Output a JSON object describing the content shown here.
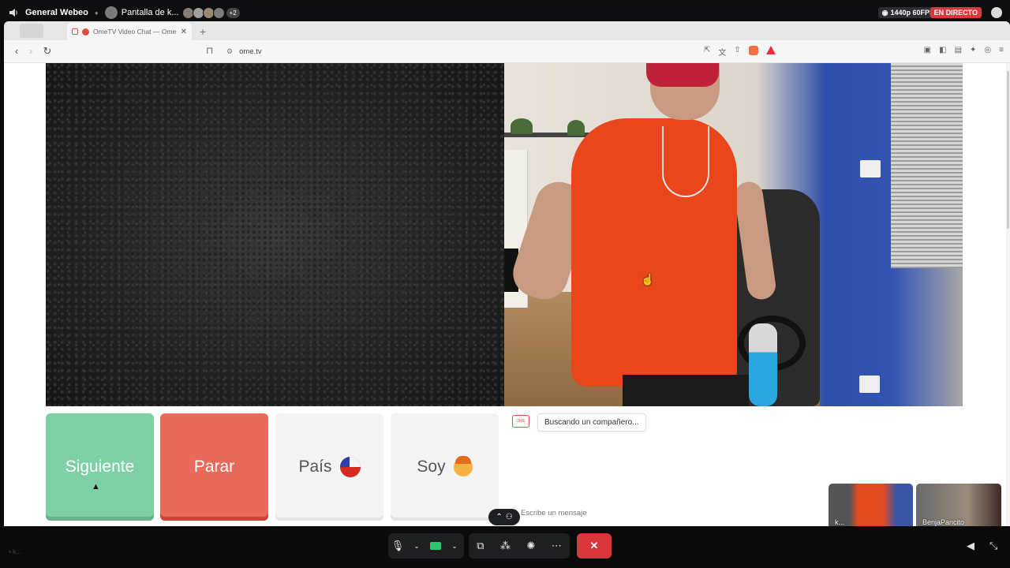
{
  "discord": {
    "channel_name": "General Webeo",
    "stream_title": "Pantalla de k...",
    "extra_viewers": "+2",
    "quality": "1440p 60FPS",
    "live_label": "EN DIRECTO"
  },
  "browser": {
    "tab_title": "OmeTV Video Chat — Ome",
    "url": "ome.tv"
  },
  "ometv": {
    "buttons": {
      "next": "Siguiente",
      "stop": "Parar",
      "country": "País",
      "me": "Soy"
    },
    "chat_status": "Buscando un compañero...",
    "chat_placeholder": "Escribe un mensaje"
  },
  "participants": [
    {
      "label": "k..."
    },
    {
      "label": "BenjaPancito"
    }
  ],
  "bottom_left_label": "k..."
}
